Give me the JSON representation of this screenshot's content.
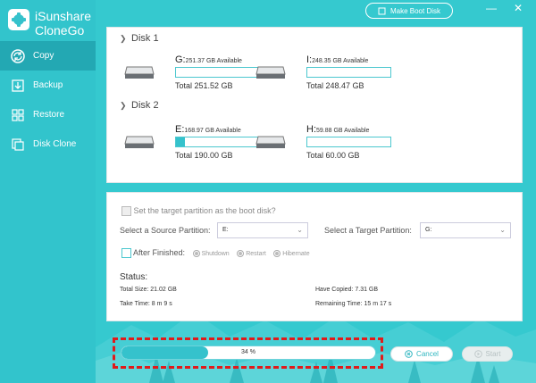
{
  "app": {
    "name_line1": "iSunshare",
    "name_line2": "CloneGo",
    "boot_button": "Make Boot Disk",
    "min_symbol": "—",
    "close_symbol": "✕"
  },
  "sidebar": {
    "items": [
      {
        "label": "Copy",
        "icon": "copy-icon",
        "active": true
      },
      {
        "label": "Backup",
        "icon": "backup-icon",
        "active": false
      },
      {
        "label": "Restore",
        "icon": "restore-icon",
        "active": false
      },
      {
        "label": "Disk Clone",
        "icon": "disk-clone-icon",
        "active": false
      }
    ]
  },
  "disks": [
    {
      "name": "Disk 1",
      "partitions": [
        {
          "letter": "G:",
          "available": "251.37 GB Available",
          "total": "Total 251.52 GB",
          "used_fraction": 0.0
        },
        {
          "letter": "I:",
          "available": "248.35 GB Available",
          "total": "Total 248.47 GB",
          "used_fraction": 0.0
        }
      ]
    },
    {
      "name": "Disk 2",
      "partitions": [
        {
          "letter": "E:",
          "available": "168.97 GB Available",
          "total": "Total 190.00 GB",
          "used_fraction": 0.11
        },
        {
          "letter": "H:",
          "available": "59.88 GB Available",
          "total": "Total 60.00 GB",
          "used_fraction": 0.0
        }
      ]
    }
  ],
  "settings": {
    "boot_checkbox_label": "Set the target partition as the boot disk?",
    "source_label": "Select a Source Partition:",
    "source_value": "E:",
    "target_label": "Select a Target Partition:",
    "target_value": "G:",
    "after_finished_label": "After Finished:",
    "options": [
      "Shutdown",
      "Restart",
      "Hibernate"
    ]
  },
  "status": {
    "title": "Status:",
    "total_size": "Total Size: 21.02 GB",
    "have_copied": "Have Copied: 7.31 GB",
    "take_time": "Take Time: 8 m 9 s",
    "remaining_time": "Remaining Time: 15 m 17 s"
  },
  "progress": {
    "value": 0.34,
    "label": "34 %"
  },
  "buttons": {
    "cancel": "Cancel",
    "start": "Start"
  },
  "colors": {
    "accent": "#35c2cc",
    "sidebar_active": "#23a8b3",
    "highlight_dash": "#e01b1b"
  }
}
